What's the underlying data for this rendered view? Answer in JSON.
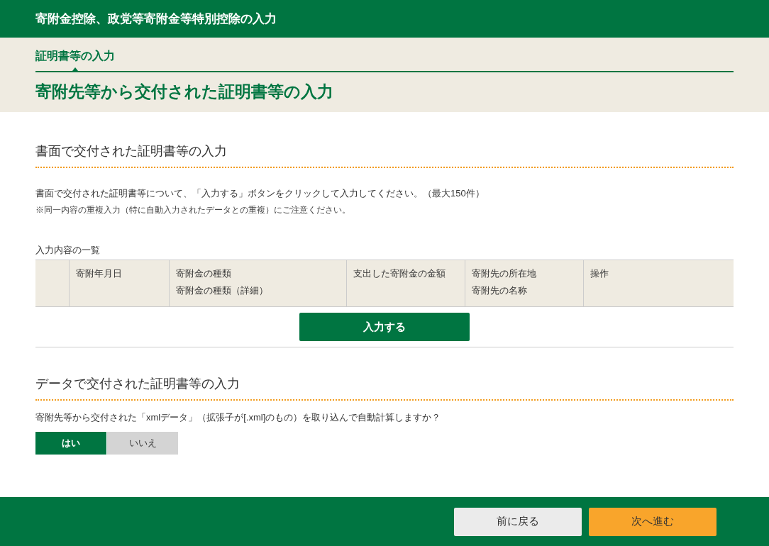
{
  "header": {
    "title": "寄附金控除、政党等寄附金等特別控除の入力"
  },
  "steps": [
    {
      "label": "証明書等の入力",
      "selected": true
    }
  ],
  "page_title": "寄附先等から交付された証明書等の入力",
  "paper_section": {
    "heading": "書面で交付された証明書等の入力",
    "description": "書面で交付された証明書等について、「入力する」ボタンをクリックして入力してください。（最大150件）",
    "note": "※同一内容の重複入力（特に自動入力されたデータとの重複）にご注意ください。",
    "table": {
      "caption": "入力内容の一覧",
      "columns": [
        {},
        {
          "lines": [
            "寄附年月日"
          ]
        },
        {
          "lines": [
            "寄附金の種類",
            "寄附金の種類（詳細）"
          ]
        },
        {
          "lines": [
            "支出した寄附金の金額"
          ]
        },
        {
          "lines": [
            "寄附先の所在地",
            "寄附先の名称"
          ]
        },
        {
          "lines": [
            "操作"
          ]
        }
      ]
    },
    "input_button": "入力する"
  },
  "data_section": {
    "heading": "データで交付された証明書等の入力",
    "question": "寄附先等から交付された「xmlデータ」（拡張子が[.xml]のもの）を取り込んで自動計算しますか？",
    "options": [
      {
        "label": "はい",
        "selected": true
      },
      {
        "label": "いいえ",
        "selected": false
      }
    ]
  },
  "footer": {
    "buttons": [
      {
        "label": "前に戻る",
        "kind": "back"
      },
      {
        "label": "次へ進む",
        "kind": "next"
      }
    ]
  }
}
